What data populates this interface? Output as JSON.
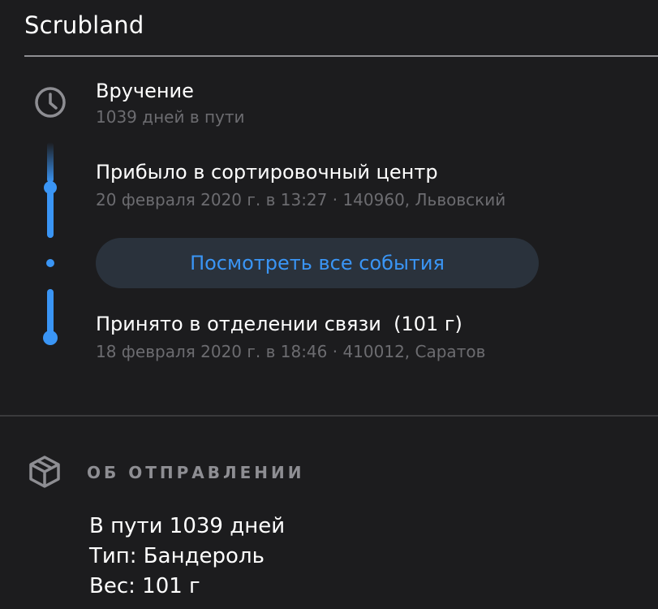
{
  "header": {
    "title": "Scrubland"
  },
  "tracking": {
    "status": {
      "title": "Вручение",
      "subtitle": "1039 дней в пути"
    },
    "events": [
      {
        "title": "Прибыло в сортировочный центр",
        "subtitle": "20 февраля 2020 г. в 13:27 · 140960, Львовский"
      },
      {
        "title": "Принято в отделении связи  (101 г)",
        "subtitle": "18 февраля 2020 г. в 18:46 · 410012, Саратов"
      }
    ],
    "all_events_label": "Посмотреть все события"
  },
  "shipment": {
    "section_title": "ОБ ОТПРАВЛЕНИИ",
    "lines": [
      "В пути 1039 дней",
      "Тип: Бандероль",
      "Вес: 101 г"
    ]
  },
  "icons": {
    "status": "clock-icon",
    "shipment": "box-icon"
  },
  "colors": {
    "background": "#1c1c1e",
    "accent": "#3a95f5",
    "secondary_text": "#6c6c70",
    "button_bg": "#2a323c"
  }
}
